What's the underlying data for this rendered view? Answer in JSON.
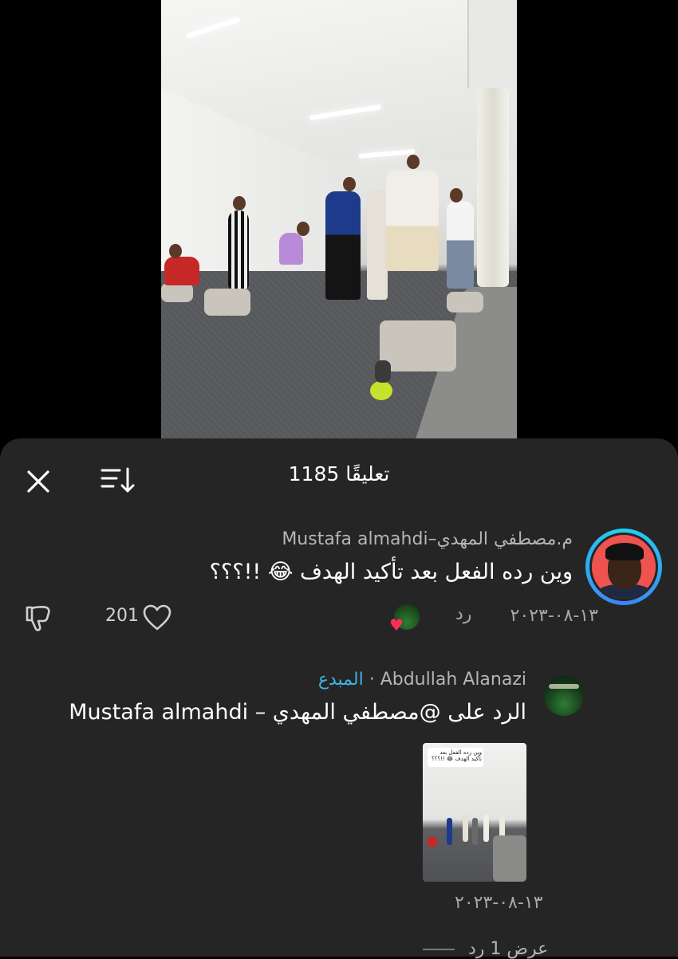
{
  "video": {
    "description_icon": "video-still"
  },
  "header": {
    "title": "1185 تعليقًا",
    "close_icon": "close-icon",
    "sort_icon": "sort-icon"
  },
  "comments": [
    {
      "author": "م.مصطفي المهدي–Mustafa almahdi",
      "text": "وين رده الفعل بعد تأكيد الهدف 😂 !!؟؟؟",
      "date": "١٣-٠٨-٢٠٢٣",
      "reply_label": "رد",
      "likes": "201"
    }
  ],
  "reply": {
    "author": "Abdullah Alanazi",
    "separator": "·",
    "badge": "المبدع",
    "text": "الرد على @مصطفي المهدي – Mustafa almahdi",
    "date": "١٣-٠٨-٢٠٢٣",
    "thumb_caption": "وين رده الفعل بعد تأكيد الهدف 😂 !!؟؟؟"
  },
  "view_more": "عرض 1 رد",
  "colors": {
    "sheet": "#252525",
    "badge": "#3db5e6",
    "like_heart": "#ff2d55"
  }
}
